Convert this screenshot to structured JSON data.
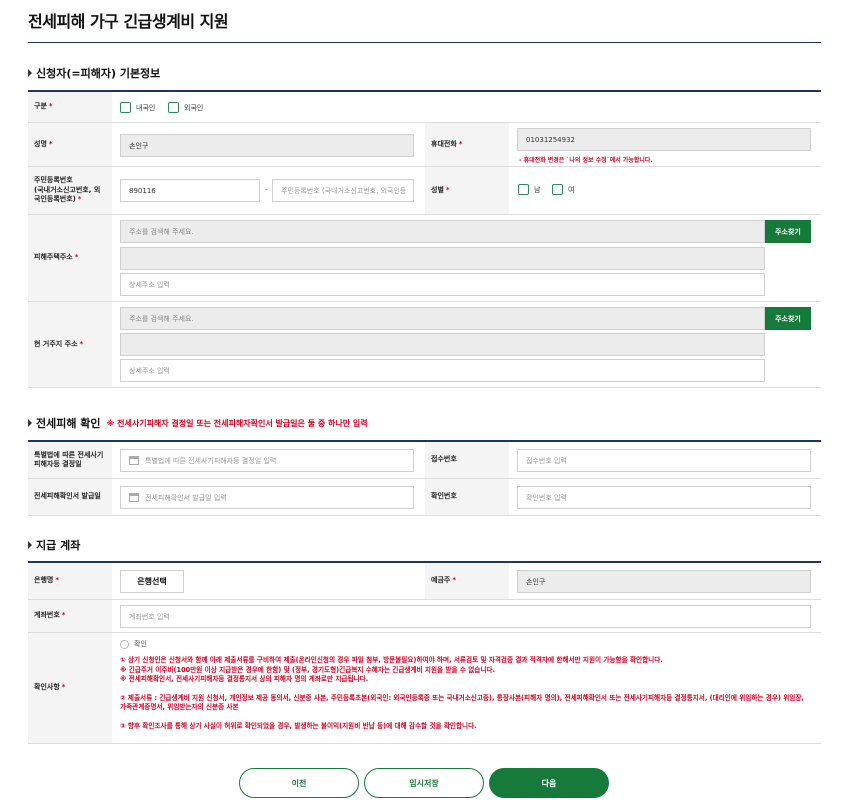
{
  "page": {
    "title": "전세피해 가구 긴급생계비 지원"
  },
  "applicant": {
    "heading": "신청자(=피해자) 기본정보",
    "category": {
      "label": "구분",
      "options": [
        "내국인",
        "외국인"
      ]
    },
    "name": {
      "label": "성명",
      "value": "손인구"
    },
    "phone": {
      "label": "휴대전화",
      "value": "01031254932",
      "help": "- 휴대전화 변경은 `나의 정보 수정`에서 가능합니다."
    },
    "rrn": {
      "label_line1": "주민등록번호",
      "label_line2": "(국내거소신고번호, 외",
      "label_line3": "국인등록번호)",
      "front_value": "890116",
      "back_placeholder": "주민등록번호 (국내거소신고번호, 외국인등"
    },
    "gender": {
      "label": "성별",
      "options": [
        "남",
        "여"
      ]
    },
    "damaged_address": {
      "label": "피해주택주소",
      "search_placeholder": "주소를 검색해 주세요.",
      "search_button": "주소찾기",
      "detail_placeholder": "상세주소 입력"
    },
    "current_address": {
      "label": "현 거주지 주소",
      "search_placeholder": "주소를 검색해 주세요.",
      "search_button": "주소찾기",
      "detail_placeholder": "상세주소 입력"
    }
  },
  "damage": {
    "heading": "전세피해 확인",
    "note": "※ 전세사기피해자 결정일 또는 전세피해자확인서 발급일은 둘 중 하나만 입력",
    "decision": {
      "label_line1": "특별법에 따른 전세사기",
      "label_line2": "피해자등 결정일",
      "placeholder": "특별법에 따른 전세사기피해자등 결정일 입력"
    },
    "receipt": {
      "label": "접수번호",
      "placeholder": "접수번호 입력"
    },
    "certificate": {
      "label": "전세피해확인서 발급일",
      "placeholder": "전세피해확인서 발급일 입력"
    },
    "confirm_no": {
      "label": "확인번호",
      "placeholder": "확인번호 입력"
    }
  },
  "account": {
    "heading": "지급 계좌",
    "bank": {
      "label": "은행명",
      "button": "은행선택"
    },
    "holder": {
      "label": "예금주",
      "value": "손인구"
    },
    "number": {
      "label": "계좌번호",
      "placeholder": "계좌번호 입력"
    },
    "confirm": {
      "label": "확인사항",
      "check_label": "확인",
      "lines": [
        "① 상기 신청인은 신청서와 함께 아래 제출서류를 구비하여 제출(온라인신청의 경우 파일 첨부, 방문불필요)하여야 하며, 서류검토 및 자격검증 결과 적격자에 한해서만 지원이 가능함을 확인합니다.",
        "※ 긴급주거 이주비(100만원 이상 지급받은 경우에 한함) 및 (정부, 경기도형)긴급복지 수혜자는 긴급생계비 지원을 받을 수 없습니다.",
        "※ 전세피해확인서, 전세사기피해자등 결정통지서 상의 피해자 명의 계좌로만 지급됩니다.",
        "② 제출서류 : 긴급생계비 지원 신청서, 개인정보 제공 동의서, 신분증 사본, 주민등록초본(외국인: 외국인등록증 또는 국내거소신고증), 통장사본(피해자 명의), 전세피해확인서 또는 전세사기피해자등 결정통지서, (대리인에 위임하는 경우) 위임장, 가족관계증명서, 위임받는자의 신분증 사본",
        "③ 향후 확인조사를 통해 상기 사실이 허위로 확인되었을 경우, 발생하는 불이익(지원비 반납 등)에 대해 감수할 것을 확인합니다."
      ]
    }
  },
  "buttons": {
    "prev": "이전",
    "save": "임시저장",
    "next": "다음"
  },
  "colors": {
    "accent": "#157a3a",
    "required": "#d4001e",
    "navy": "#1e3560"
  }
}
